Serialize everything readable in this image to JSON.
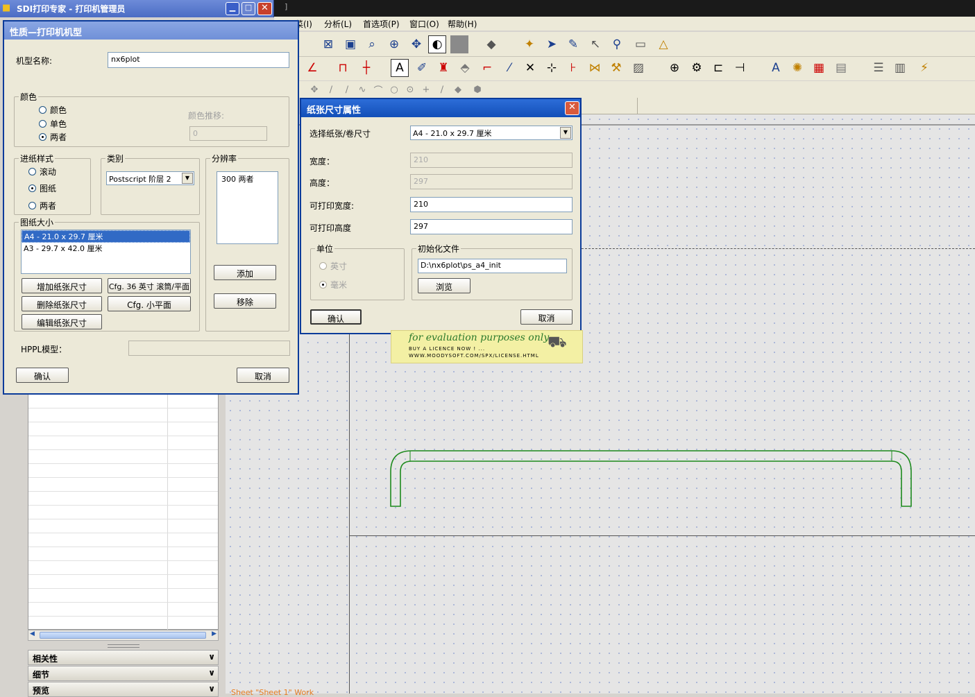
{
  "bg_app": {
    "titlebar_mark": "]",
    "menu": [
      "菜(I)",
      "分析(L)",
      "首选项(P)",
      "窗口(O)",
      "帮助(H)"
    ],
    "sections": [
      {
        "label": "相关性"
      },
      {
        "label": "细节"
      },
      {
        "label": "预览"
      }
    ],
    "bottom_text": "Sheet \"Sheet 1\" Work"
  },
  "sdi_window": {
    "title": "SDI打印专家 - 打印机管理员"
  },
  "printer_dialog": {
    "title": "性质—打印机机型",
    "model_name_label": "机型名称:",
    "model_name_value": "nx6plot",
    "color_group": "颜色",
    "color_options": [
      "颜色",
      "单色",
      "两者"
    ],
    "color_selected": "两者",
    "color_shift_label": "颜色推移:",
    "color_shift_value": "0",
    "feed_group": "进纸样式",
    "feed_options": [
      "滚动",
      "图纸",
      "两者"
    ],
    "feed_selected": "图纸",
    "category_group": "类别",
    "category_value": "Postscript 阶层 2",
    "resolution_group": "分辨率",
    "resolutions": [
      "300 两者"
    ],
    "paper_group": "图纸大小",
    "paper_sizes": [
      "A4 - 21.0 x 29.7 厘米",
      "A3 - 29.7 x 42.0 厘米"
    ],
    "paper_selected_index": 0,
    "btn_add_size": "增加纸张尺寸",
    "btn_delete_size": "删除纸张尺寸",
    "btn_edit_size": "编辑纸张尺寸",
    "btn_cfg36": "Cfg. 36 英寸 滚筒/平面",
    "btn_cfg_small": "Cfg. 小平面",
    "btn_add": "添加",
    "btn_remove": "移除",
    "hppl_label": "HPPL模型：",
    "hppl_value": "",
    "ok": "确认",
    "cancel": "取消"
  },
  "paper_dialog": {
    "title": "纸张尺寸属性",
    "select_label": "选择纸张/卷尺寸",
    "select_value": "A4 - 21.0 x 29.7 厘米",
    "width_label": "宽度：",
    "width_value": "210",
    "height_label": "高度：",
    "height_value": "297",
    "print_width_label": "可打印宽度:",
    "print_width_value": "210",
    "print_height_label": "可打印高度",
    "print_height_value": "297",
    "unit_group": "单位",
    "unit_options": [
      "英寸",
      "毫米"
    ],
    "unit_selected": "毫米",
    "init_group": "初始化文件",
    "init_value": "D:\\nx6plot\\ps_a4_init",
    "browse": "浏览",
    "ok": "确认",
    "cancel": "取消"
  },
  "watermark": {
    "line1": "for evaluation purposes only.",
    "line2": "BUY A LICENCE NOW ! ...",
    "line3": "WWW.MOODYSOFT.COM/SPX/LICENSE.HTML"
  },
  "colors": {
    "title_blue": "#124fb8",
    "drawing_green": "#1d8a1d",
    "dialog_bg": "#ece9d8"
  }
}
